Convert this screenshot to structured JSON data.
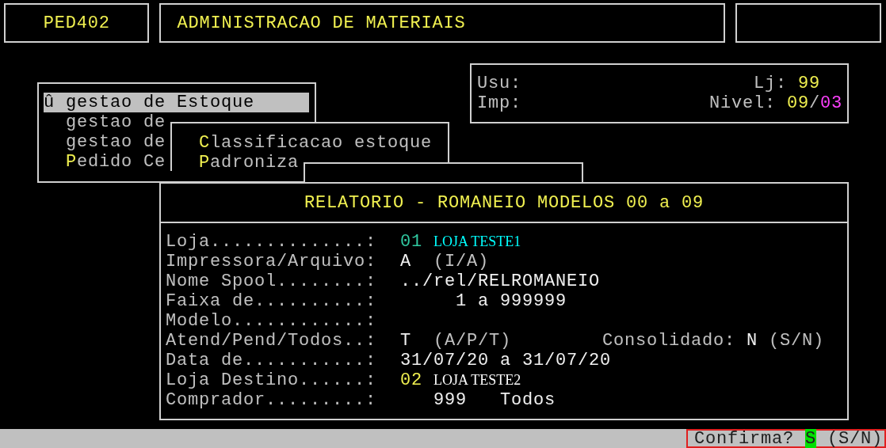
{
  "header": {
    "code": "PED402",
    "title": "ADMINISTRACAO DE MATERIAIS"
  },
  "user_panel": {
    "usu_label": "Usu:",
    "imp_label": "Imp:",
    "lj_label": "Lj:",
    "lj_value": "99",
    "nivel_label": "Nivel:",
    "nivel_value": "09",
    "nivel_sep": "/",
    "nivel_sub": "03"
  },
  "menu": {
    "items": [
      {
        "marker": "û",
        "label": "gestao de Estoque",
        "selected": true,
        "hotkey": false
      },
      {
        "label": "gestao de",
        "selected": false,
        "hotkey": false
      },
      {
        "label": "gestao de",
        "selected": false,
        "hotkey": false
      },
      {
        "label": "Pedido Ce",
        "selected": false,
        "hotkey": true
      }
    ]
  },
  "submenu": {
    "items": [
      {
        "label": "Classificacao estoque",
        "selected": false,
        "hotkey": true
      },
      {
        "label": "Padroniza",
        "selected": false,
        "hotkey": true
      }
    ]
  },
  "report": {
    "title": "RELATORIO - ROMANEIO MODELOS 00 a 09",
    "rows": [
      {
        "label": "Loja..............:",
        "values": [
          {
            "kind": "code",
            "text": "01",
            "color": "#30c8a0"
          },
          {
            "kind": "name",
            "text": "LOJA TESTE1",
            "color": "#00ffff"
          }
        ]
      },
      {
        "label": "Impressora/Arquivo:",
        "values": [
          {
            "kind": "code",
            "text": "A",
            "color": "#f0f0f0"
          },
          {
            "kind": "hint",
            "text": "(I/A)",
            "color": "#c0c0c0"
          }
        ]
      },
      {
        "label": "Nome Spool........:",
        "values": [
          {
            "kind": "code",
            "text": "../rel/RELROMANEIO",
            "color": "#f0f0f0"
          }
        ]
      },
      {
        "label": "Faixa de..........:",
        "values": [
          {
            "kind": "range",
            "text": "1 a 999999",
            "color": "#f0f0f0"
          }
        ]
      },
      {
        "label": "Modelo............:",
        "values": []
      },
      {
        "label": "Atend/Pend/Todos..:",
        "values": [
          {
            "kind": "code",
            "text": "T",
            "color": "#f0f0f0"
          },
          {
            "kind": "hint",
            "text": "(A/P/T)",
            "color": "#c0c0c0"
          },
          {
            "kind": "sublabel",
            "text": "Consolidado:",
            "color": "#c0c0c0"
          },
          {
            "kind": "text",
            "text": "N",
            "color": "#f0f0f0"
          },
          {
            "kind": "text",
            "text": "(S/N)",
            "color": "#c0c0c0"
          }
        ]
      },
      {
        "label": "Data de...........:",
        "values": [
          {
            "kind": "code",
            "text": "31/07/20 a 31/07/20",
            "color": "#f0f0f0"
          }
        ]
      },
      {
        "label": "Loja Destino......:",
        "values": [
          {
            "kind": "code",
            "text": "02",
            "color": "#f0f050"
          },
          {
            "kind": "name",
            "text": "LOJA TESTE2",
            "color": "#ffffff"
          }
        ]
      },
      {
        "label": "Comprador.........:",
        "values": [
          {
            "kind": "count",
            "text": "999",
            "color": "#f0f0f0"
          },
          {
            "kind": "count",
            "text": "Todos",
            "color": "#f0f0f0"
          }
        ]
      }
    ]
  },
  "status_bar": {
    "prompt": "Confirma?",
    "answer": "S",
    "options": "(S/N)"
  }
}
